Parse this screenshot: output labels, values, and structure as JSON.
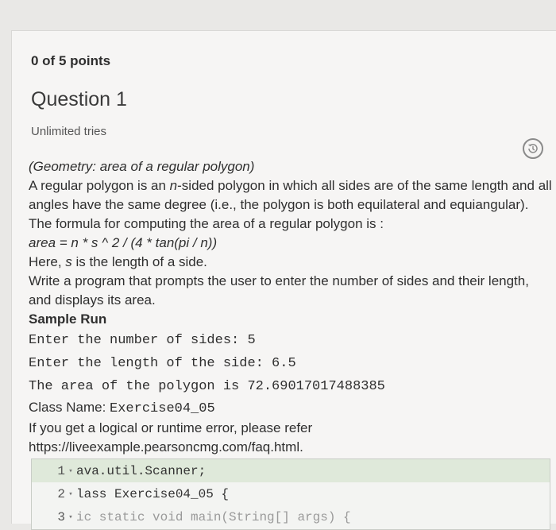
{
  "score": "0 of 5 points",
  "question": {
    "title": "Question 1",
    "tries": "Unlimited tries",
    "history_icon": "history-clock-icon"
  },
  "problem": {
    "heading": "(Geometry: area of a regular polygon)",
    "intro_a": "A regular polygon is an ",
    "intro_n": "n",
    "intro_b": "-sided polygon in which all sides are of the same length and all angles have the same degree (i.e., the polygon is both equilateral and equiangular). The formula for computing the area of a regular polygon is :",
    "formula": "area = n * s ^ 2 / (4 * tan(pi / n))",
    "here_a": "Here, ",
    "here_s": "s",
    "here_b": " is the length of a side.",
    "instruction": "Write a program that prompts the user to enter the number of sides and their length, and displays its area.",
    "sample_run_label": "Sample Run",
    "sample_lines": [
      "Enter the number of sides: 5",
      "Enter the length of the side: 6.5",
      "The area of the polygon is 72.69017017488385"
    ],
    "class_label": "Class Name: ",
    "class_name": "Exercise04_05",
    "error_note": "If you get a logical or runtime error, please refer",
    "faq_link": "https://liveexample.pearsoncmg.com/faq.html."
  },
  "code_editor": {
    "lines": [
      {
        "num": "1",
        "text": "ava.util.Scanner;"
      },
      {
        "num": "2",
        "text": "lass Exercise04_05 {"
      },
      {
        "num": "3",
        "text": "ic static void main(String[] args) {"
      }
    ]
  }
}
